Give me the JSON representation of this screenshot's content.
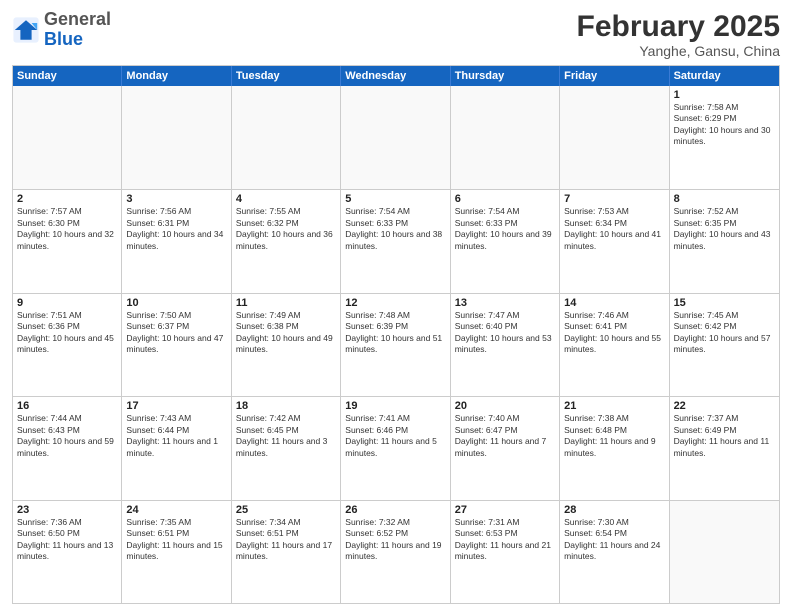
{
  "header": {
    "logo_general": "General",
    "logo_blue": "Blue",
    "month_year": "February 2025",
    "location": "Yanghe, Gansu, China"
  },
  "weekdays": [
    "Sunday",
    "Monday",
    "Tuesday",
    "Wednesday",
    "Thursday",
    "Friday",
    "Saturday"
  ],
  "rows": [
    [
      {
        "day": "",
        "info": ""
      },
      {
        "day": "",
        "info": ""
      },
      {
        "day": "",
        "info": ""
      },
      {
        "day": "",
        "info": ""
      },
      {
        "day": "",
        "info": ""
      },
      {
        "day": "",
        "info": ""
      },
      {
        "day": "1",
        "info": "Sunrise: 7:58 AM\nSunset: 6:29 PM\nDaylight: 10 hours and 30 minutes."
      }
    ],
    [
      {
        "day": "2",
        "info": "Sunrise: 7:57 AM\nSunset: 6:30 PM\nDaylight: 10 hours and 32 minutes."
      },
      {
        "day": "3",
        "info": "Sunrise: 7:56 AM\nSunset: 6:31 PM\nDaylight: 10 hours and 34 minutes."
      },
      {
        "day": "4",
        "info": "Sunrise: 7:55 AM\nSunset: 6:32 PM\nDaylight: 10 hours and 36 minutes."
      },
      {
        "day": "5",
        "info": "Sunrise: 7:54 AM\nSunset: 6:33 PM\nDaylight: 10 hours and 38 minutes."
      },
      {
        "day": "6",
        "info": "Sunrise: 7:54 AM\nSunset: 6:33 PM\nDaylight: 10 hours and 39 minutes."
      },
      {
        "day": "7",
        "info": "Sunrise: 7:53 AM\nSunset: 6:34 PM\nDaylight: 10 hours and 41 minutes."
      },
      {
        "day": "8",
        "info": "Sunrise: 7:52 AM\nSunset: 6:35 PM\nDaylight: 10 hours and 43 minutes."
      }
    ],
    [
      {
        "day": "9",
        "info": "Sunrise: 7:51 AM\nSunset: 6:36 PM\nDaylight: 10 hours and 45 minutes."
      },
      {
        "day": "10",
        "info": "Sunrise: 7:50 AM\nSunset: 6:37 PM\nDaylight: 10 hours and 47 minutes."
      },
      {
        "day": "11",
        "info": "Sunrise: 7:49 AM\nSunset: 6:38 PM\nDaylight: 10 hours and 49 minutes."
      },
      {
        "day": "12",
        "info": "Sunrise: 7:48 AM\nSunset: 6:39 PM\nDaylight: 10 hours and 51 minutes."
      },
      {
        "day": "13",
        "info": "Sunrise: 7:47 AM\nSunset: 6:40 PM\nDaylight: 10 hours and 53 minutes."
      },
      {
        "day": "14",
        "info": "Sunrise: 7:46 AM\nSunset: 6:41 PM\nDaylight: 10 hours and 55 minutes."
      },
      {
        "day": "15",
        "info": "Sunrise: 7:45 AM\nSunset: 6:42 PM\nDaylight: 10 hours and 57 minutes."
      }
    ],
    [
      {
        "day": "16",
        "info": "Sunrise: 7:44 AM\nSunset: 6:43 PM\nDaylight: 10 hours and 59 minutes."
      },
      {
        "day": "17",
        "info": "Sunrise: 7:43 AM\nSunset: 6:44 PM\nDaylight: 11 hours and 1 minute."
      },
      {
        "day": "18",
        "info": "Sunrise: 7:42 AM\nSunset: 6:45 PM\nDaylight: 11 hours and 3 minutes."
      },
      {
        "day": "19",
        "info": "Sunrise: 7:41 AM\nSunset: 6:46 PM\nDaylight: 11 hours and 5 minutes."
      },
      {
        "day": "20",
        "info": "Sunrise: 7:40 AM\nSunset: 6:47 PM\nDaylight: 11 hours and 7 minutes."
      },
      {
        "day": "21",
        "info": "Sunrise: 7:38 AM\nSunset: 6:48 PM\nDaylight: 11 hours and 9 minutes."
      },
      {
        "day": "22",
        "info": "Sunrise: 7:37 AM\nSunset: 6:49 PM\nDaylight: 11 hours and 11 minutes."
      }
    ],
    [
      {
        "day": "23",
        "info": "Sunrise: 7:36 AM\nSunset: 6:50 PM\nDaylight: 11 hours and 13 minutes."
      },
      {
        "day": "24",
        "info": "Sunrise: 7:35 AM\nSunset: 6:51 PM\nDaylight: 11 hours and 15 minutes."
      },
      {
        "day": "25",
        "info": "Sunrise: 7:34 AM\nSunset: 6:51 PM\nDaylight: 11 hours and 17 minutes."
      },
      {
        "day": "26",
        "info": "Sunrise: 7:32 AM\nSunset: 6:52 PM\nDaylight: 11 hours and 19 minutes."
      },
      {
        "day": "27",
        "info": "Sunrise: 7:31 AM\nSunset: 6:53 PM\nDaylight: 11 hours and 21 minutes."
      },
      {
        "day": "28",
        "info": "Sunrise: 7:30 AM\nSunset: 6:54 PM\nDaylight: 11 hours and 24 minutes."
      },
      {
        "day": "",
        "info": ""
      }
    ]
  ]
}
